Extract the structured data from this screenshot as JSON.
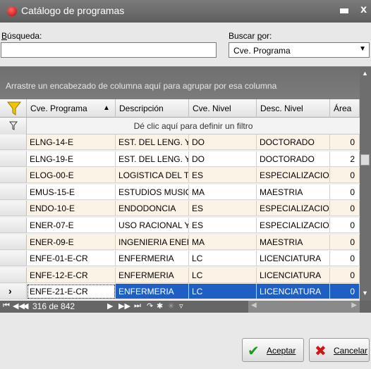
{
  "window": {
    "title": "Catálogo de programas",
    "close": "x"
  },
  "search": {
    "label": "Búsqueda:",
    "value": ""
  },
  "search_by": {
    "label": "Buscar por:",
    "selected": "Cve. Programa"
  },
  "grid": {
    "group_hint": "Arrastre un encabezado de columna aquí para agrupar por esa columna",
    "filter_hint": "Dé clic aquí para definir un filtro",
    "columns": [
      "Cve. Programa",
      "Descripción",
      "Cve. Nivel",
      "Desc. Nivel",
      "Área"
    ],
    "sort_indicator": "▲",
    "rows": [
      [
        "ELNG-14-E",
        "EST. DEL LENG. Y",
        "DO",
        "DOCTORADO",
        "0"
      ],
      [
        "ELNG-19-E",
        "EST. DEL LENG. Y",
        "DO",
        "DOCTORADO",
        "2"
      ],
      [
        "ELOG-00-E",
        "LOGISTICA DEL T",
        "ES",
        "ESPECIALIZACIO",
        "0"
      ],
      [
        "EMUS-15-E",
        "ESTUDIOS MUSIC",
        "MA",
        "MAESTRIA",
        "0"
      ],
      [
        "ENDO-10-E",
        "ENDODONCIA",
        "ES",
        "ESPECIALIZACIO",
        "0"
      ],
      [
        "ENER-07-E",
        "USO RACIONAL Y",
        "ES",
        "ESPECIALIZACIO",
        "0"
      ],
      [
        "ENER-09-E",
        "INGENIERIA ENER",
        "MA",
        "MAESTRIA",
        "0"
      ],
      [
        "ENFE-01-E-CR",
        "ENFERMERIA",
        "LC",
        "LICENCIATURA",
        "0"
      ],
      [
        "ENFE-12-E-CR",
        "ENFERMERIA",
        "LC",
        "LICENCIATURA",
        "0"
      ],
      [
        "ENFE-21-E-CR",
        "ENFERMERIA",
        "LC",
        "LICENCIATURA",
        "0"
      ]
    ],
    "current_row": 9
  },
  "navigator": {
    "position": "316 de 842"
  },
  "buttons": {
    "accept": "Aceptar",
    "cancel": "Cancelar"
  }
}
